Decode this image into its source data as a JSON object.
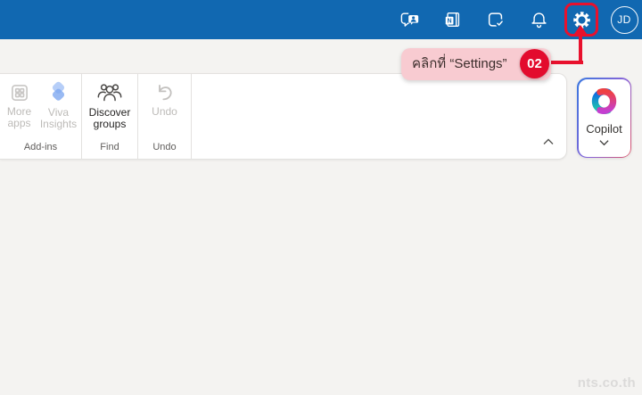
{
  "topbar": {
    "avatar_initials": "JD",
    "icons": [
      {
        "name": "chat-icon"
      },
      {
        "name": "onenote-feed-icon",
        "badge_letter": "N"
      },
      {
        "name": "my-day-check-icon"
      },
      {
        "name": "notifications-bell-icon"
      },
      {
        "name": "settings-gear-icon"
      }
    ]
  },
  "annotation": {
    "text": "คลิกที่ “Settings”",
    "step": "02"
  },
  "ribbon": {
    "groups": [
      {
        "label": "Add-ins",
        "buttons": [
          {
            "label": "More apps",
            "icon": "apps-grid-icon",
            "disabled": true
          },
          {
            "label": "Viva Insights",
            "icon": "viva-insights-icon",
            "disabled": true
          }
        ]
      },
      {
        "label": "Find",
        "buttons": [
          {
            "label": "Discover groups",
            "icon": "people-group-icon",
            "disabled": false
          }
        ]
      },
      {
        "label": "Undo",
        "buttons": [
          {
            "label": "Undo",
            "icon": "undo-arrow-icon",
            "disabled": true
          }
        ]
      }
    ],
    "collapse_icon": "chevron-up-icon"
  },
  "copilot": {
    "label": "Copilot",
    "chevron": "chevron-down-icon"
  },
  "watermark": {
    "text": "nts.co.th"
  },
  "colors": {
    "topbar_blue": "#1168b1",
    "annotation_pink": "#f8cbd1",
    "annotation_red": "#e8112d",
    "badge_red": "#e30b2d",
    "page_background": "#f4f3f1",
    "copilot_border_left": "#3a78e0",
    "copilot_border_right": "#e05568"
  }
}
